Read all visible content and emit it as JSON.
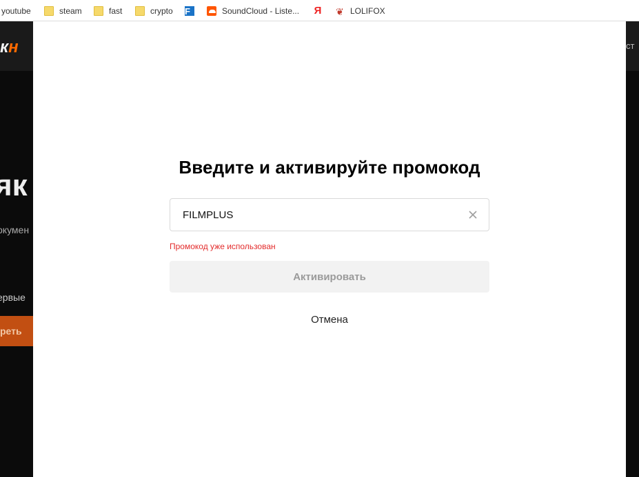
{
  "bookmarks": [
    {
      "label": "youtube",
      "icon": "folder-icon"
    },
    {
      "label": "steam",
      "icon": "folder-icon"
    },
    {
      "label": "fast",
      "icon": "folder-icon"
    },
    {
      "label": "crypto",
      "icon": "folder-icon"
    },
    {
      "label": "",
      "icon": "f-app-icon"
    },
    {
      "label": "SoundCloud - Liste...",
      "icon": "soundcloud-icon"
    },
    {
      "label": "",
      "icon": "yandex-icon",
      "glyph": "Я"
    },
    {
      "label": "LOLIFOX",
      "icon": "lolifox-icon"
    }
  ],
  "background_page": {
    "logo_prefix": "к",
    "logo_accent": "н",
    "header_right": "ст",
    "headline": "як",
    "subtext": "окумен",
    "subtext2": "ервые",
    "button_label": "реть"
  },
  "modal": {
    "title": "Введите и активируйте промокод",
    "promo_value": "FILMPLUS",
    "error": "Промокод уже использован",
    "activate_label": "Активировать",
    "cancel_label": "Отмена"
  },
  "colors": {
    "error": "#e32b2b",
    "accent": "#ff6a00",
    "button_disabled_bg": "#f2f2f2"
  }
}
